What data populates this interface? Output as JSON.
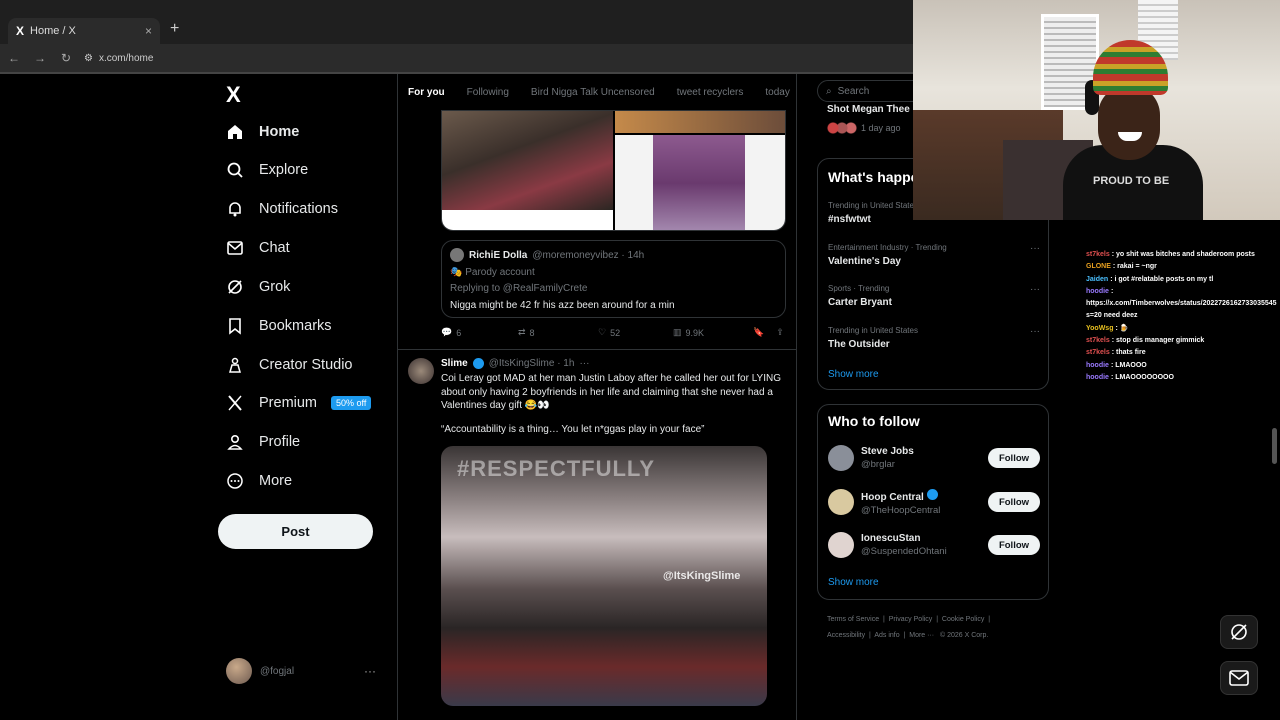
{
  "browser": {
    "tab_title": "Home / X",
    "tab_logo": "X",
    "tab_close": "×",
    "new_tab": "+",
    "url": "x.com/home"
  },
  "nav": {
    "logo": "X",
    "items": [
      {
        "label": "Home",
        "icon": "home-icon"
      },
      {
        "label": "Explore",
        "icon": "search-icon"
      },
      {
        "label": "Notifications",
        "icon": "bell-icon"
      },
      {
        "label": "Chat",
        "icon": "mail-icon"
      },
      {
        "label": "Grok",
        "icon": "grok-icon"
      },
      {
        "label": "Bookmarks",
        "icon": "bookmark-icon"
      },
      {
        "label": "Creator Studio",
        "icon": "creator-icon"
      },
      {
        "label": "Premium",
        "icon": "x-icon"
      },
      {
        "label": "Profile",
        "icon": "person-icon"
      },
      {
        "label": "More",
        "icon": "more-circle-icon"
      }
    ],
    "premium_badge": "50% off",
    "post_button": "Post",
    "user_handle": "@fogjal",
    "user_more": "···"
  },
  "feed": {
    "tabs": [
      "For you",
      "Following",
      "Bird Nigga Talk Uncensored",
      "tweet recyclers",
      "today"
    ],
    "quote": {
      "name": "RichiE Dolla",
      "handle": "@moremoneyvibez · 14h",
      "label": "Parody account",
      "replying": "Replying to @RealFamilyCrete",
      "text": "Nigga might be 42 fr his azz been around for a min"
    },
    "actions": {
      "replies": "6",
      "reposts": "8",
      "likes": "52",
      "views": "9.9K"
    },
    "tweet2": {
      "name": "Slime",
      "handle": "@ItsKingSlime · 1h",
      "body": "Coi Leray got MAD at her man Justin Laboy after he called her out for LYING about only having 2 boyfriends in her life and claiming that she never had a Valentines day gift 😂👀",
      "quote": "“Accountability is a thing… You let n*ggas play in your face”",
      "overlay_top": "#RESPECTFULLY",
      "overlay_wm": "@ItsKingSlime"
    }
  },
  "sidebar": {
    "search_placeholder": "Search",
    "snippet_title": "Shot Megan Thee",
    "snippet_time": "1 day ago",
    "happening_title": "What's happening",
    "trends": [
      {
        "meta": "Trending in United States",
        "title": "#nsfwtwt"
      },
      {
        "meta": "Entertainment Industry · Trending",
        "title": "Valentine's Day"
      },
      {
        "meta": "Sports · Trending",
        "title": "Carter Bryant"
      },
      {
        "meta": "Trending in United States",
        "title": "The Outsider"
      }
    ],
    "show_more": "Show more",
    "who_title": "Who to follow",
    "follows": [
      {
        "name": "Steve Jobs",
        "handle": "@brglar",
        "color": "#8a8f99"
      },
      {
        "name": "Hoop Central",
        "handle": "@TheHoopCentral",
        "color": "#d9c9a0"
      },
      {
        "name": "IonescuStan",
        "handle": "@SuspendedOhtani",
        "color": "#e0d4d0"
      }
    ],
    "follow_label": "Follow",
    "show_more2": "Show more",
    "footer": [
      "Terms of Service",
      "Privacy Policy",
      "Cookie Policy",
      "Accessibility",
      "Ads info",
      "More ···",
      "© 2026 X Corp."
    ]
  },
  "webcam": {
    "shirt_text": "PROUD TO BE"
  },
  "chat": [
    {
      "user": "st7kels",
      "color": "#e05050",
      "msg": ": yo shit was bitches and shaderoom posts"
    },
    {
      "user": "GLONE",
      "color": "#e8a020",
      "msg": ": rakai = ~ngr"
    },
    {
      "user": "Jaiden",
      "color": "#4ac0ff",
      "msg": ": i got #relatable posts on my tl"
    },
    {
      "user": "hoodie",
      "color": "#9a7aff",
      "msg": ":"
    },
    {
      "user": "",
      "color": "#ffffff",
      "msg": "https://x.com/Timberwolves/status/2022726162733035545"
    },
    {
      "user": "",
      "color": "#ffffff",
      "msg": "s=20 need deez"
    },
    {
      "user": "YooWsg",
      "color": "#e8c020",
      "msg": ": 🍺"
    },
    {
      "user": "st7kels",
      "color": "#e05050",
      "msg": ": stop dis manager gimmick"
    },
    {
      "user": "st7kels",
      "color": "#e05050",
      "msg": ": thats fire"
    },
    {
      "user": "hoodie",
      "color": "#9a7aff",
      "msg": ": LMAOOO"
    },
    {
      "user": "hoodie",
      "color": "#9a7aff",
      "msg": ": LMAOOOOOOOO"
    }
  ]
}
